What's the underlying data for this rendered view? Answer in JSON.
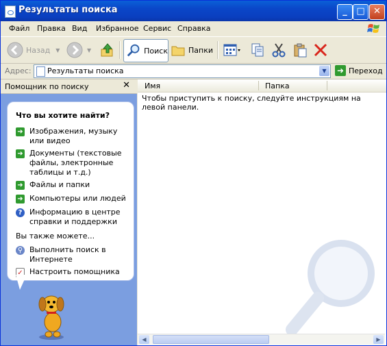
{
  "window": {
    "title": "Результаты поиска"
  },
  "menu": [
    "Файл",
    "Правка",
    "Вид",
    "Избранное",
    "Сервис",
    "Справка"
  ],
  "toolbar": {
    "back_label": "Назад",
    "search_label": "Поиск",
    "folders_label": "Папки"
  },
  "address": {
    "label": "Адрес:",
    "value": "Результаты поиска",
    "go_label": "Переход"
  },
  "search_assistant": {
    "header": "Помощник по поиску",
    "question": "Что вы хотите найти?",
    "options": [
      "Изображения, музыку или видео",
      "Документы (текстовые файлы, электронные таблицы и т.д.)",
      "Файлы и папки",
      "Компьютеры или людей",
      "Информацию в центре справки и поддержки"
    ],
    "also_label": "Вы также можете...",
    "also_options": [
      "Выполнить поиск в Интернете",
      "Настроить помощника"
    ]
  },
  "results": {
    "columns": [
      "Имя",
      "Папка"
    ],
    "message": "Чтобы приступить к поиску, следуйте инструкциям на левой панели."
  },
  "colors": {
    "titlebar": "#0a46c8",
    "pane": "#7b9ee0",
    "green_arrow": "#2f9a2f"
  }
}
